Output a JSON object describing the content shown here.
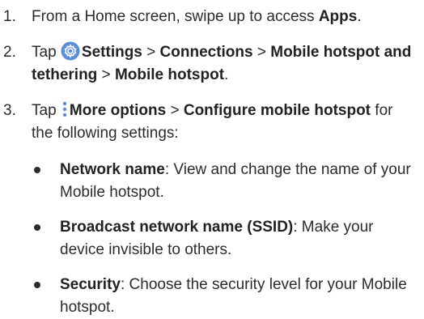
{
  "steps": [
    {
      "number": "1.",
      "prefix": "From a Home screen, swipe up to access ",
      "bold1": "Apps",
      "suffix": "."
    },
    {
      "number": "2.",
      "tap": "Tap ",
      "settings": "Settings",
      "sep": " > ",
      "connections": "Connections",
      "hotspot_tethering": "Mobile hotspot and tethering",
      "hotspot": "Mobile hotspot",
      "end": "."
    },
    {
      "number": "3.",
      "tap": "Tap ",
      "more_options": "More options",
      "sep": " > ",
      "configure": "Configure mobile hotspot",
      "rest": " for the following settings:"
    }
  ],
  "bullets": [
    {
      "term": "Network name",
      "text": ": View and change the name of your Mobile hotspot."
    },
    {
      "term": "Broadcast network name (SSID)",
      "text": ": Make your device invisible to others."
    },
    {
      "term": "Security",
      "text": ": Choose the security level for your Mobile hotspot."
    }
  ],
  "icons": {
    "settings_icon": "settings-gear-icon",
    "more_icon": "more-options-vertical-dots-icon",
    "accent": "#5b8ed6"
  }
}
